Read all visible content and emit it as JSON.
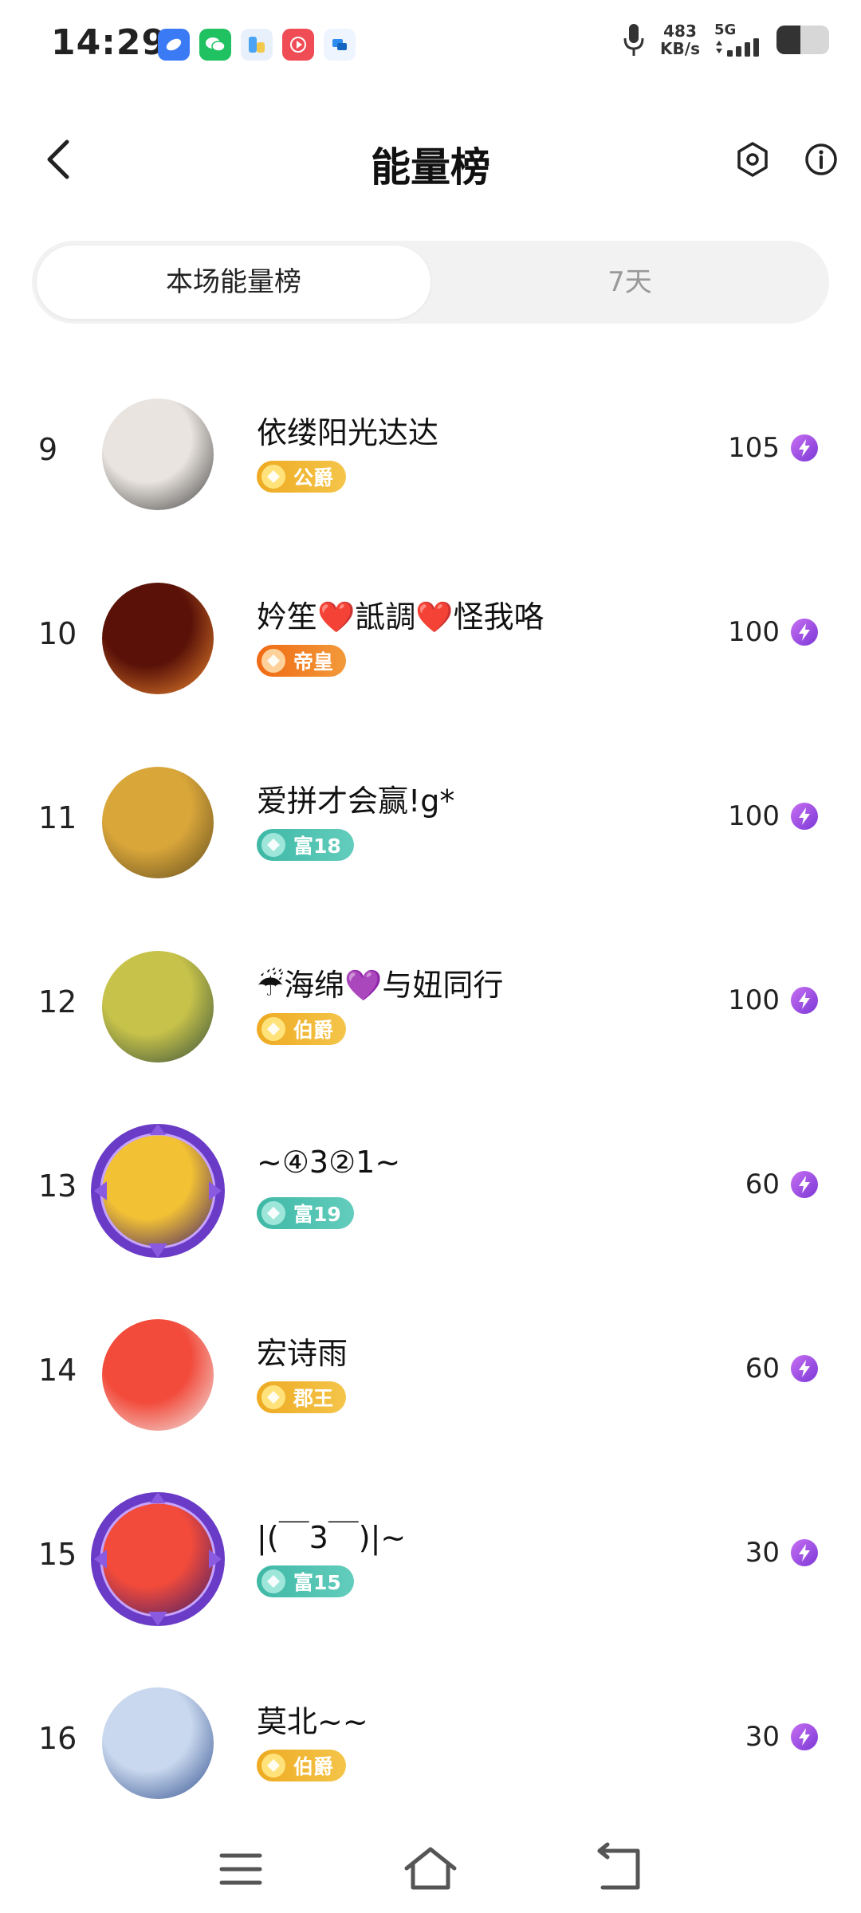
{
  "status_bar": {
    "time": "14:29",
    "speed_value": "483",
    "speed_unit": "KB/s",
    "network": "5G",
    "battery_level": 0.45,
    "app_icons": [
      {
        "name": "app-icon-1",
        "color": "#3a7bf5"
      },
      {
        "name": "wechat-icon",
        "color": "#20c160"
      },
      {
        "name": "app-icon-3",
        "color": "#4aa3f5"
      },
      {
        "name": "video-app-icon",
        "color": "#f04c55"
      },
      {
        "name": "app-icon-5",
        "color": "#2d8cf0"
      }
    ]
  },
  "header": {
    "title": "能量榜"
  },
  "tabs": [
    {
      "label": "本场能量榜",
      "active": true
    },
    {
      "label": "7天",
      "active": false
    }
  ],
  "colors": {
    "gold_badge": "#f0b12a",
    "orange_badge": "#f07a1a",
    "teal_badge": "#3fb8a6",
    "energy_purple": "#8b4de0"
  },
  "rows": [
    {
      "rank": "9",
      "name": "依缕阳光达达",
      "badge": "公爵",
      "badge_type": "gold",
      "score": "105",
      "avatar_colors": [
        "#e9e4df",
        "#3b3b3b"
      ]
    },
    {
      "rank": "10",
      "name": "妗笙❤️詆調❤️怪我咯",
      "badge": "帝皇",
      "badge_type": "orange",
      "score": "100",
      "avatar_colors": [
        "#5a1208",
        "#f08a30"
      ]
    },
    {
      "rank": "11",
      "name": "爱拼才会赢!g*",
      "badge": "富18",
      "badge_type": "teal",
      "score": "100",
      "avatar_colors": [
        "#d9a63a",
        "#5e4a1e"
      ]
    },
    {
      "rank": "12",
      "name": "☔海绵💜与妞同行",
      "badge": "伯爵",
      "badge_type": "gold",
      "score": "100",
      "avatar_colors": [
        "#c7c24a",
        "#2f4a3a"
      ]
    },
    {
      "rank": "13",
      "name": "~④3②1~",
      "badge": "富19",
      "badge_type": "teal",
      "score": "60",
      "avatar_colors": [
        "#f3c234",
        "#3a1a6a"
      ],
      "framed": true
    },
    {
      "rank": "14",
      "name": "宏诗雨",
      "badge": "郡王",
      "badge_type": "gold",
      "score": "60",
      "avatar_colors": [
        "#f24b3b",
        "#f1f1f1"
      ]
    },
    {
      "rank": "15",
      "name": "|(￣3￣)|~",
      "badge": "富15",
      "badge_type": "teal",
      "score": "30",
      "avatar_colors": [
        "#f24b3b",
        "#3a1a6a"
      ],
      "framed": true
    },
    {
      "rank": "16",
      "name": "莫北~~",
      "badge": "伯爵",
      "badge_type": "gold",
      "score": "30",
      "avatar_colors": [
        "#c9d8ee",
        "#2a4a8a"
      ]
    }
  ],
  "nav_bar": {
    "buttons": [
      "menu",
      "home",
      "back"
    ]
  }
}
